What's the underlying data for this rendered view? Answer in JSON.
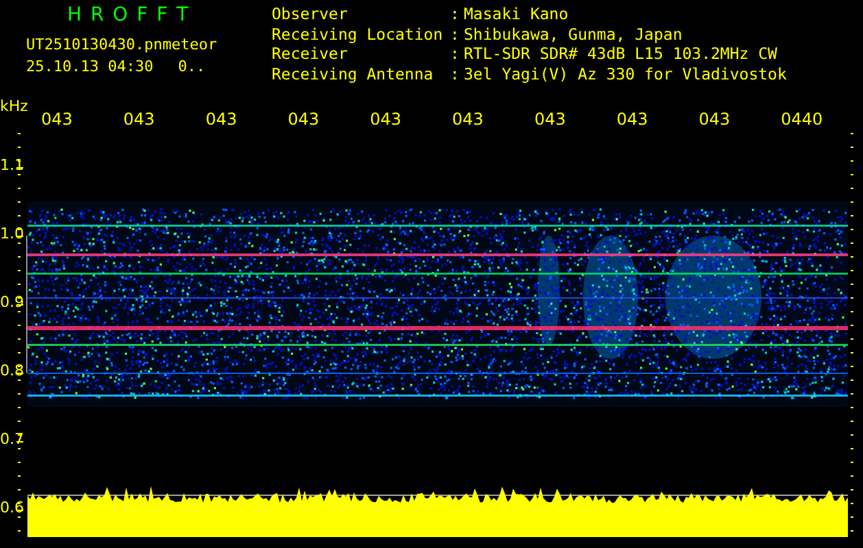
{
  "app": {
    "title": "H R O F F T",
    "file_name": "UT2510130430.pn",
    "mode": "meteor",
    "timestamp": "25.10.13 04:30",
    "value": "0.."
  },
  "info": [
    {
      "label": "Observer",
      "sep": ":",
      "value": "Masaki Kano"
    },
    {
      "label": "Receiving Location",
      "sep": ":",
      "value": "Shibukawa, Gunma, Japan"
    },
    {
      "label": "Receiver",
      "sep": ":",
      "value": "RTL-SDR SDR# 43dB L15 103.2MHz CW"
    },
    {
      "label": "Receiving Antenna",
      "sep": ":",
      "value": "3el Yagi(V) Az 330 for Vladivostok"
    }
  ],
  "axis": {
    "unit": "kHz",
    "time_labels": [
      "043",
      "043",
      "043",
      "043",
      "043",
      "043",
      "043",
      "043",
      "043",
      "0440"
    ],
    "freq_labels": [
      "1.1",
      "1.0",
      "0.9",
      "0.8",
      "0.7",
      "0.6"
    ]
  }
}
